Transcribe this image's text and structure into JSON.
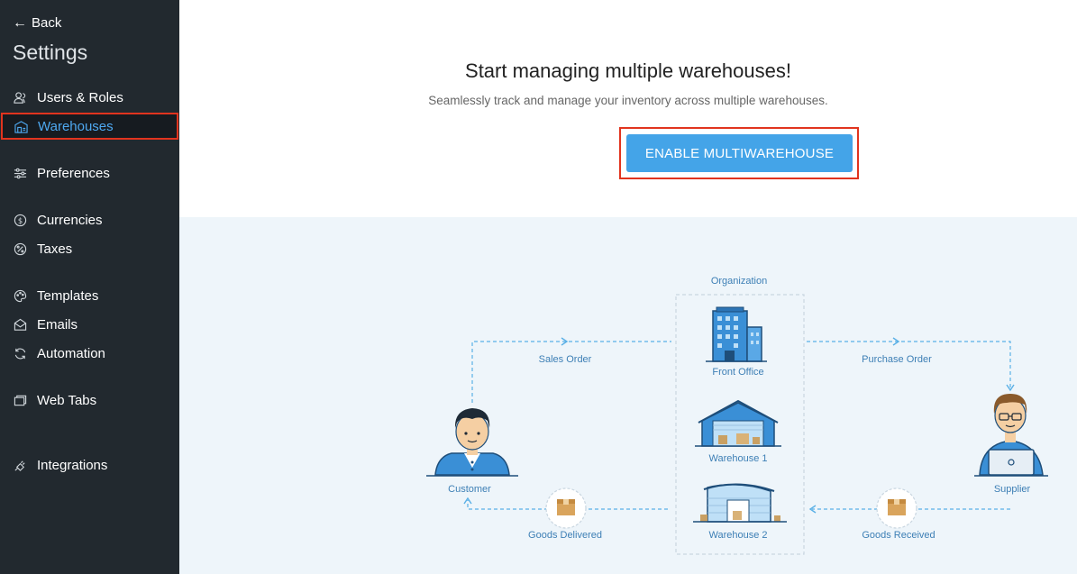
{
  "sidebar": {
    "back_label": "Back",
    "title": "Settings",
    "items": [
      {
        "label": "Users & Roles",
        "icon": "users-icon"
      },
      {
        "label": "Warehouses",
        "icon": "warehouse-icon",
        "active": true
      },
      {
        "label": "Preferences",
        "icon": "sliders-icon"
      },
      {
        "label": "Currencies",
        "icon": "dollar-icon"
      },
      {
        "label": "Taxes",
        "icon": "percent-icon"
      },
      {
        "label": "Templates",
        "icon": "palette-icon"
      },
      {
        "label": "Emails",
        "icon": "mail-icon"
      },
      {
        "label": "Automation",
        "icon": "refresh-icon"
      },
      {
        "label": "Web Tabs",
        "icon": "tabs-icon"
      },
      {
        "label": "Integrations",
        "icon": "plug-icon"
      }
    ]
  },
  "main": {
    "headline": "Start managing multiple warehouses!",
    "subline": "Seamlessly track and manage your inventory across multiple warehouses.",
    "cta_label": "ENABLE MULTIWAREHOUSE"
  },
  "diagram": {
    "organization": "Organization",
    "front_office": "Front Office",
    "warehouse1": "Warehouse 1",
    "warehouse2": "Warehouse 2",
    "sales_order": "Sales Order",
    "purchase_order": "Purchase Order",
    "customer": "Customer",
    "supplier": "Supplier",
    "goods_delivered": "Goods Delivered",
    "goods_received": "Goods Received"
  },
  "colors": {
    "sidebar_bg": "#22292f",
    "active_text": "#4ea8f0",
    "highlight_border": "#e1341e",
    "cta_bg": "#44a4e8",
    "diagram_bg": "#eef5fa"
  }
}
